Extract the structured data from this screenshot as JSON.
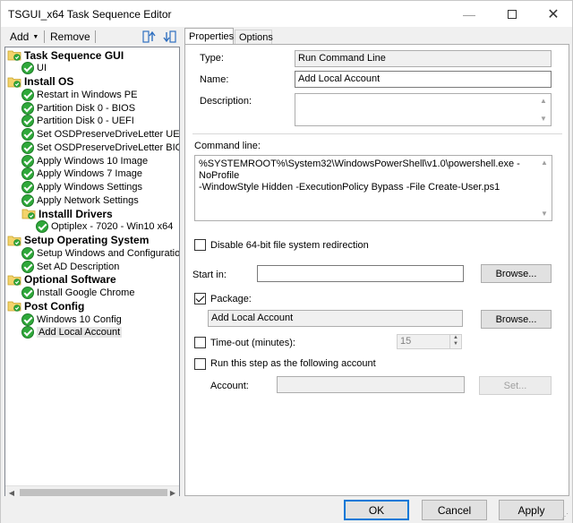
{
  "window": {
    "title": "TSGUI_x64 Task Sequence Editor"
  },
  "toolbar": {
    "add_label": "Add",
    "remove_label": "Remove"
  },
  "tree": {
    "items": [
      {
        "label": "Task Sequence GUI",
        "type": "group"
      },
      {
        "label": "UI",
        "type": "step"
      },
      {
        "label": "Install OS",
        "type": "group"
      },
      {
        "label": "Restart in Windows PE",
        "type": "step"
      },
      {
        "label": "Partition Disk 0 - BIOS",
        "type": "step"
      },
      {
        "label": "Partition Disk 0 - UEFI",
        "type": "step"
      },
      {
        "label": "Set OSDPreserveDriveLetter UEFI",
        "type": "step"
      },
      {
        "label": "Set OSDPreserveDriveLetter BIOS",
        "type": "step"
      },
      {
        "label": "Apply Windows 10 Image",
        "type": "step"
      },
      {
        "label": "Apply Windows 7 Image",
        "type": "step"
      },
      {
        "label": "Apply Windows Settings",
        "type": "step"
      },
      {
        "label": "Apply Network Settings",
        "type": "step"
      },
      {
        "label": "Installl Drivers",
        "type": "group"
      },
      {
        "label": "Optiplex - 7020 - Win10 x64",
        "type": "step"
      },
      {
        "label": "Setup Operating System",
        "type": "group"
      },
      {
        "label": "Setup Windows and Configuration",
        "type": "step"
      },
      {
        "label": "Set AD Description",
        "type": "step"
      },
      {
        "label": "Optional Software",
        "type": "group"
      },
      {
        "label": "Install Google Chrome",
        "type": "step"
      },
      {
        "label": "Post Config",
        "type": "group"
      },
      {
        "label": "Windows 10 Config",
        "type": "step"
      },
      {
        "label": "Add Local Account",
        "type": "step",
        "selected": true
      }
    ]
  },
  "tabs": {
    "properties": "Properties",
    "options": "Options"
  },
  "form": {
    "type_label": "Type:",
    "type_value": "Run Command Line",
    "name_label": "Name:",
    "name_value": "Add Local Account",
    "description_label": "Description:",
    "description_value": "",
    "command_label": "Command line:",
    "command_line1": "%SYSTEMROOT%\\System32\\WindowsPowerShell\\v1.0\\powershell.exe -NoProfile",
    "command_line2": "-WindowStyle Hidden -ExecutionPolicy Bypass -File Create-User.ps1",
    "disable64_label": "Disable 64-bit file system redirection",
    "disable64_checked": false,
    "startin_label": "Start in:",
    "startin_value": "",
    "browse1_label": "Browse...",
    "package_label": "Package:",
    "package_checked": true,
    "package_value": "Add Local Account",
    "browse2_label": "Browse...",
    "timeout_label": "Time-out (minutes):",
    "timeout_checked": false,
    "timeout_value": "15",
    "runas_label": "Run this step as the following account",
    "runas_checked": false,
    "account_label": "Account:",
    "account_value": "",
    "set_label": "Set..."
  },
  "footer": {
    "ok_label": "OK",
    "cancel_label": "Cancel",
    "apply_label": "Apply"
  }
}
